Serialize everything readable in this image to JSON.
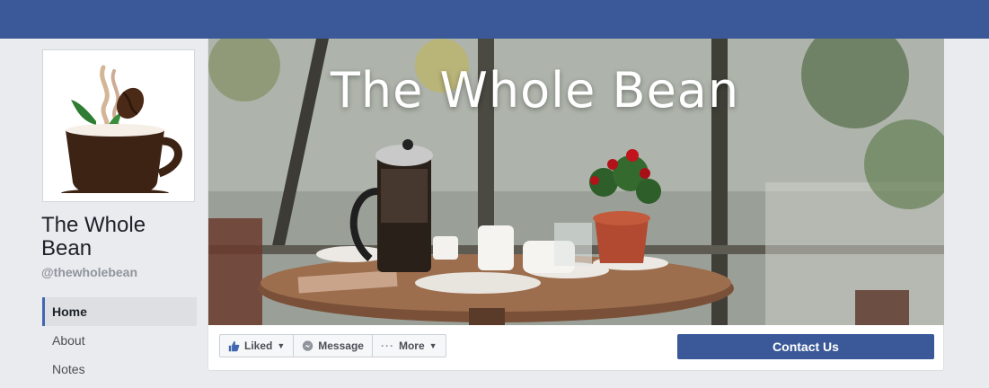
{
  "page": {
    "name": "The Whole Bean",
    "handle": "@thewholebean",
    "cover_title": "The Whole Bean"
  },
  "nav": {
    "items": [
      {
        "label": "Home"
      },
      {
        "label": "About"
      },
      {
        "label": "Notes"
      }
    ]
  },
  "actions": {
    "liked_label": "Liked",
    "message_label": "Message",
    "more_label": "More",
    "contact_label": "Contact Us"
  },
  "colors": {
    "topbar": "#3b5998",
    "accent": "#4267b2",
    "cup": "#3d2314",
    "leaf": "#2e7d32"
  },
  "icons": {
    "liked": "thumbs-up-icon",
    "message": "messenger-icon",
    "more": "ellipsis-icon",
    "caret": "chevron-down-icon"
  }
}
